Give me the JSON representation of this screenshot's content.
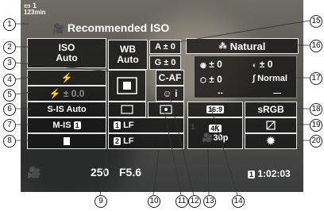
{
  "top": {
    "battery": "1",
    "remaining_time": "123min"
  },
  "mode": {
    "title": "Recommended ISO"
  },
  "settings": {
    "iso": [
      "ISO",
      "Auto"
    ],
    "wb": [
      "WB",
      "Auto"
    ],
    "wb_a": "A ± 0",
    "wb_g": "G ± 0",
    "picture_mode": "Natural",
    "flash": "⚡",
    "flash_comp": "⚡ ± 0.0",
    "af_mode": "C-AF",
    "face_priority": "☺ i",
    "is_still": "S-IS Auto",
    "is_movie": "M-IS",
    "is_movie_num": "1",
    "sharpness": "± 0",
    "contrast": "± 0",
    "saturation": "± 0",
    "gradation": "Normal",
    "color_space": "sRGB",
    "aspect": "16:9",
    "video_quality_top": "4K",
    "video_quality_bottom": "30p",
    "card1": "1",
    "card1_label": "LF",
    "card2": "2",
    "card2_label": "LF",
    "card_slot": "1",
    "placeholder_dashes_1": "--",
    "placeholder_dashes_2": "—"
  },
  "bottom": {
    "shutter": "250",
    "aperture": "F5.6",
    "rec_time": "1:02:03",
    "rec_slot": "1"
  },
  "callouts": [
    "1",
    "2",
    "3",
    "4",
    "5",
    "6",
    "7",
    "8",
    "9",
    "10",
    "11",
    "12",
    "13",
    "14",
    "15",
    "16",
    "17",
    "18",
    "19",
    "20"
  ]
}
